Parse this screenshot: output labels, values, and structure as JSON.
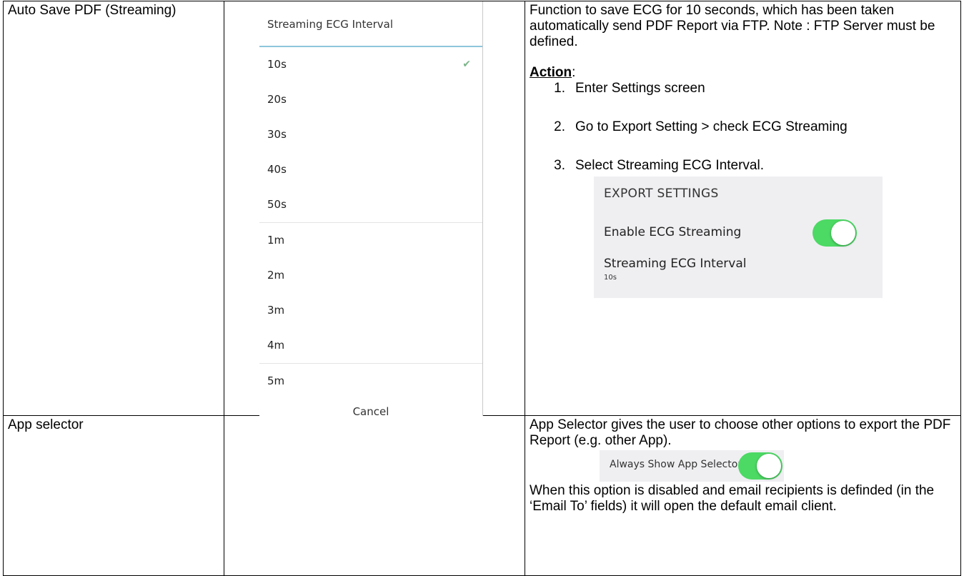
{
  "rows": [
    {
      "feature": "Auto Save PDF (Streaming)",
      "picker": {
        "title": "Streaming ECG Interval",
        "options": [
          "10s",
          "20s",
          "30s",
          "40s",
          "50s",
          "1m",
          "2m",
          "3m",
          "4m",
          "5m"
        ],
        "selected": "10s",
        "cancel_label": "Cancel"
      },
      "description": {
        "text": "Function to save ECG for 10 seconds, which has been taken automatically send PDF Report via FTP. Note : FTP Server must be defined.",
        "action_label": "Action",
        "steps": [
          {
            "num": "1.",
            "text": "Enter Settings screen"
          },
          {
            "num": "2.",
            "text": "Go to Export Setting > check ECG Streaming"
          },
          {
            "num": "3.",
            "text": "Select Streaming ECG Interval."
          }
        ],
        "export_settings": {
          "heading": "EXPORT SETTINGS",
          "streaming_label": "Enable ECG Streaming",
          "streaming_enabled": true,
          "interval_label": "Streaming ECG Interval",
          "interval_value": "10s"
        }
      }
    },
    {
      "feature": "App selector",
      "description": {
        "text": "App Selector gives  the user to choose other options to export the PDF Report (e.g. other App).",
        "toggle_label": "Always Show App Selector",
        "toggle_enabled": true,
        "text2": "When this option is disabled and email recipients is definded (in the ‘Email To’ fields) it will open the default email client."
      }
    }
  ],
  "colors": {
    "toggle_on": "#4cd964",
    "divider_accent": "#8ec6dc",
    "panel_bg": "#efeff2"
  }
}
